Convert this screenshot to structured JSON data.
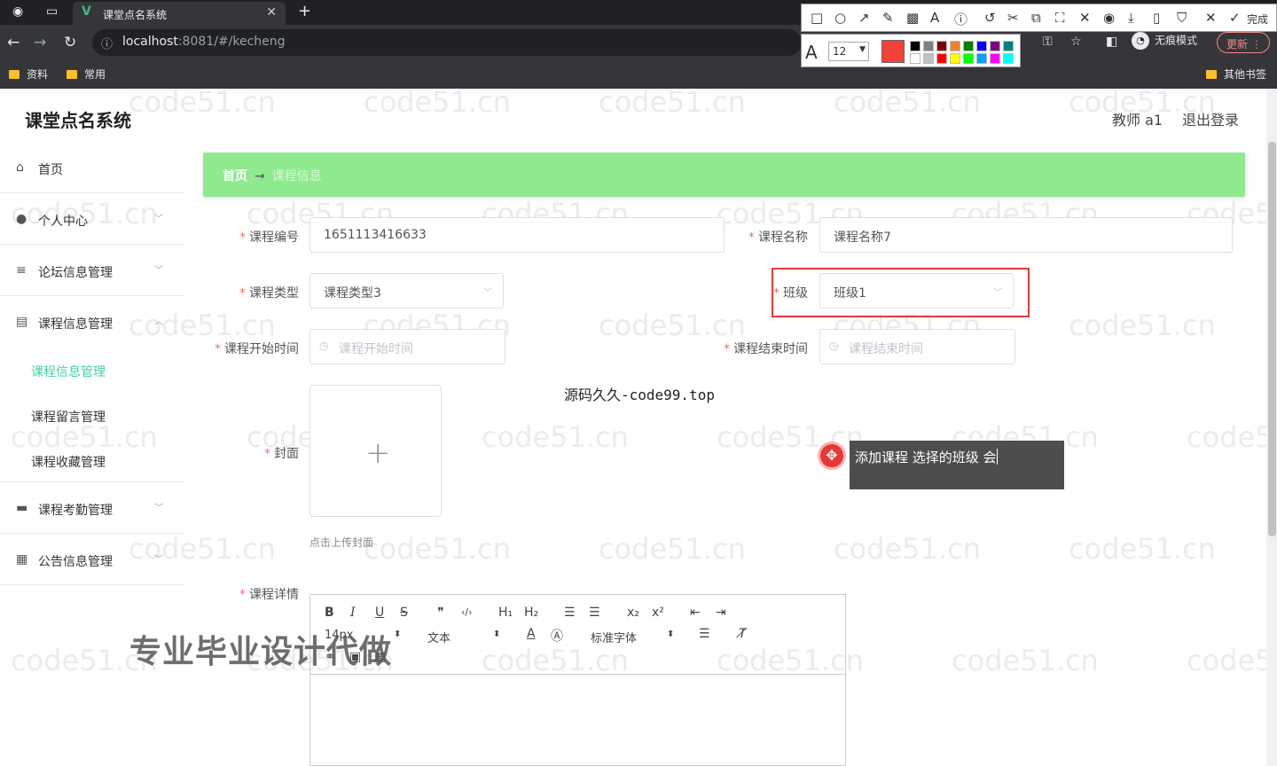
{
  "browser": {
    "tab_title": "课堂点名系统",
    "tab_icon": "V",
    "url_host": "localhost",
    "url_rest": ":8081/#/kecheng",
    "incognito_label": "无痕模式",
    "update_label": "更新",
    "bookmarks": [
      "资料",
      "常用"
    ],
    "other_bookmarks": "其他书签"
  },
  "annotation_tool": {
    "done_label": "完成",
    "font_size": "12",
    "current_color": "#f44336",
    "palette": [
      "#000000",
      "#808080",
      "#800000",
      "#f08030",
      "#008000",
      "#0000ff",
      "#800080",
      "#008080",
      "#ffffff",
      "#c0c0c0",
      "#ff0000",
      "#ffff00",
      "#00ff00",
      "#00a0ff",
      "#ff00ff",
      "#00ffff"
    ]
  },
  "app": {
    "title": "课堂点名系统",
    "user": "教师 a1",
    "logout": "退出登录"
  },
  "sidebar": {
    "items": [
      {
        "label": "首页",
        "icon": "home-icon",
        "glyph": "⌂"
      },
      {
        "label": "个人中心",
        "icon": "user-icon",
        "glyph": "●"
      },
      {
        "label": "论坛信息管理",
        "icon": "list-icon",
        "glyph": "≡"
      },
      {
        "label": "课程信息管理",
        "icon": "document-icon",
        "glyph": "▤"
      },
      {
        "label": "课程考勤管理",
        "icon": "briefcase-icon",
        "glyph": "▬"
      },
      {
        "label": "公告信息管理",
        "icon": "grid-icon",
        "glyph": "▦"
      }
    ],
    "sub_items": [
      "课程信息管理",
      "课程留言管理",
      "课程收藏管理"
    ]
  },
  "breadcrumb": {
    "home": "首页",
    "arrow": "→",
    "current": "课程信息"
  },
  "form": {
    "course_code_label": "课程编号",
    "course_code_value": "1651113416633",
    "course_name_label": "课程名称",
    "course_name_value": "课程名称7",
    "course_type_label": "课程类型",
    "course_type_value": "课程类型3",
    "class_label": "班级",
    "class_value": "班级1",
    "start_label": "课程开始时间",
    "start_placeholder": "课程开始时间",
    "end_label": "课程结束时间",
    "end_placeholder": "课程结束时间",
    "cover_label": "封面",
    "cover_tip": "点击上传封面",
    "detail_label": "课程详情"
  },
  "editor": {
    "font_size": "14px",
    "heading": "文本",
    "font_family": "标准字体",
    "buttons": [
      "B",
      "I",
      "U",
      "S",
      "❞",
      "‹/›",
      "H₁",
      "H₂",
      "☰",
      "☰",
      "x₂",
      "x²",
      "⇤",
      "⇥"
    ]
  },
  "overlay": {
    "center_text": "源码久久-code99.top",
    "tooltip_text": "添加课程 选择的班级 会",
    "big_watermark": "专业毕业设计代做",
    "tiled_watermark": "code51.cn"
  }
}
